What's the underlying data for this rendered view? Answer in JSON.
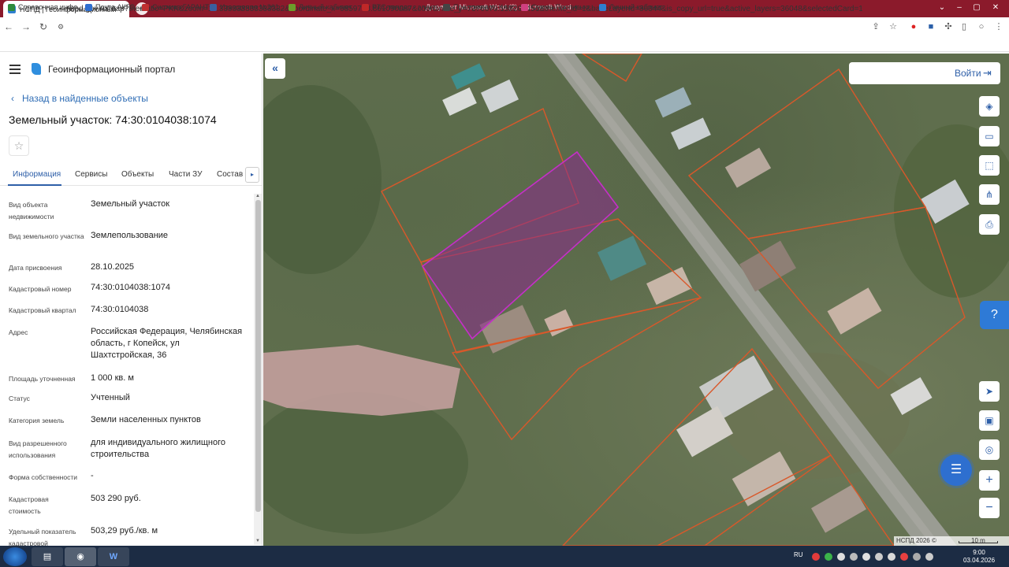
{
  "browser": {
    "tab_title": "НСПД | Геоинформационный п",
    "tab_close": "×",
    "new_tab": "+",
    "window_title": "Документ Microsoft Word (2) - Microsoft Word",
    "url": "nspd.gov.ru/map?thematic=PKK&zoom=19.333333333333332&coordinate_x=6859788.861090087&coordinate_y=7376679.152208456&theme_id=1&baseLayerId=36344&is_copy_url=true&active_layers=36048&selectedCard=1132844992%2...",
    "bookmarks": [
      {
        "label": "Справочная инфо...",
        "color": "#2e8b3d"
      },
      {
        "label": "Почта АКГО",
        "color": "#2f6fd0"
      },
      {
        "label": "Система ГАРАНТ",
        "color": "#c03030"
      },
      {
        "label": "Извещение №261...",
        "color": "#3a5fa0"
      },
      {
        "label": "Личный кабинет...",
        "color": "#6b9e2a"
      },
      {
        "label": "РТС-тендер - элект...",
        "color": "#c02828"
      },
      {
        "label": "Приложение. Клас...",
        "color": "#444444"
      },
      {
        "label": "Сумма Прописью...",
        "color": "#d04080"
      },
      {
        "label": "Личный кабинет",
        "color": "#2f7fd0"
      }
    ]
  },
  "panel": {
    "portal_name": "Геоинформационный портал",
    "back_label": "Назад в найденные объекты",
    "object_title": "Земельный участок: 74:30:0104038:1074",
    "star": "☆",
    "tabs": [
      "Информация",
      "Сервисы",
      "Объекты",
      "Части ЗУ",
      "Состав"
    ],
    "tab_next": "▸",
    "fields": [
      {
        "label": "Вид объекта недвижимости",
        "value": "Земельный участок"
      },
      {
        "label": "Вид земельного участка",
        "value": "Землепользование"
      },
      {
        "label": "Дата присвоения",
        "value": "28.10.2025"
      },
      {
        "label": "Кадастровый номер",
        "value": "74:30:0104038:1074"
      },
      {
        "label": "Кадастровый квартал",
        "value": "74:30:0104038"
      },
      {
        "label": "Адрес",
        "value": "Российская Федерация, Челябинская область, г Копейск, ул Шахтстройская, 36"
      },
      {
        "label": "Площадь уточненная",
        "value": "1 000 кв. м"
      },
      {
        "label": "Статус",
        "value": "Учтенный"
      },
      {
        "label": "Категория земель",
        "value": "Земли населенных пунктов"
      },
      {
        "label": "Вид разрешенного использования",
        "value": "для индивидуального жилищного строительства"
      },
      {
        "label": "Форма собственности",
        "value": "-"
      },
      {
        "label": "Кадастровая стоимость",
        "value": "503 290 руб."
      },
      {
        "label": "Удельный показатель кадастровой",
        "value": "503,29 руб./кв. м"
      }
    ]
  },
  "map": {
    "collapse_icon": "«",
    "login_label": "Войти",
    "login_icon": "⇥",
    "tools": [
      {
        "name": "layers-icon",
        "glyph": "◈"
      },
      {
        "name": "ruler-icon",
        "glyph": "▭"
      },
      {
        "name": "select-area-icon",
        "glyph": "⬚"
      },
      {
        "name": "share-icon",
        "glyph": "⋔"
      },
      {
        "name": "print-icon",
        "glyph": "⎙"
      }
    ],
    "help_icon": "?",
    "bottom_tools": [
      {
        "name": "locate-icon",
        "glyph": "➤"
      },
      {
        "name": "minimap-icon",
        "glyph": "▣"
      },
      {
        "name": "geo-pin-icon",
        "glyph": "◎"
      },
      {
        "name": "zoom-in-icon",
        "glyph": "+"
      },
      {
        "name": "zoom-out-icon",
        "glyph": "−"
      }
    ],
    "chat_icon": "☰",
    "copyright": "НСПД 2026 ©",
    "scale_label": "10 m"
  },
  "taskbar": {
    "apps": [
      {
        "name": "explorer-app",
        "glyph": "▤"
      },
      {
        "name": "chrome-app",
        "glyph": "◉"
      },
      {
        "name": "word-app",
        "glyph": "W"
      }
    ],
    "lang": "RU",
    "time": "9:00",
    "date": "03.04.2026"
  }
}
